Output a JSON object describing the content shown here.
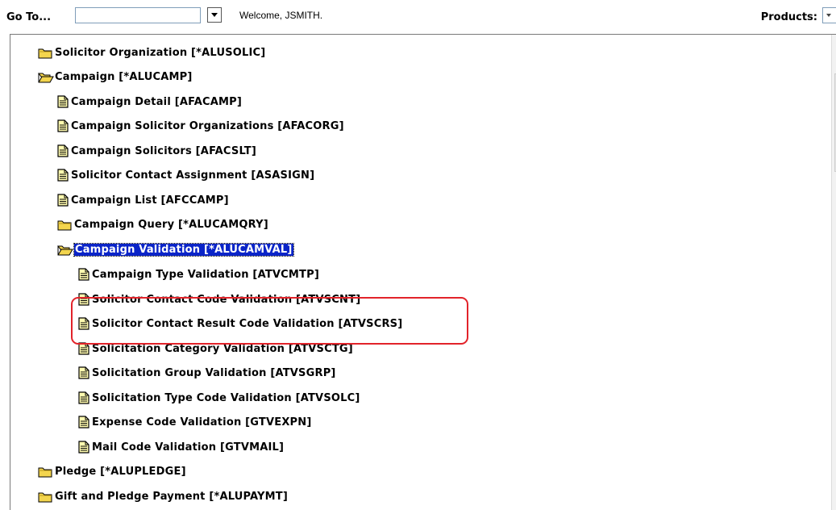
{
  "toolbar": {
    "goto_label": "Go To...",
    "goto_value": "",
    "welcome_text": "Welcome, JSMITH.",
    "products_label": "Products:"
  },
  "tree": {
    "items": [
      {
        "label": "Solicitor Organization [*ALUSOLIC]",
        "type": "folder"
      },
      {
        "label": "Campaign [*ALUCAMP]",
        "type": "folder-open"
      },
      {
        "label": "Campaign Detail [AFACAMP]",
        "type": "document"
      },
      {
        "label": "Campaign Solicitor Organizations [AFACORG]",
        "type": "document"
      },
      {
        "label": "Campaign Solicitors [AFACSLT]",
        "type": "document"
      },
      {
        "label": "Solicitor Contact Assignment [ASASIGN]",
        "type": "document"
      },
      {
        "label": "Campaign List [AFCCAMP]",
        "type": "document"
      },
      {
        "label": "Campaign Query [*ALUCAMQRY]",
        "type": "folder"
      },
      {
        "label": "Campaign Validation [*ALUCAMVAL]",
        "type": "folder-open",
        "selected": true
      },
      {
        "label": "Campaign Type Validation [ATVCMTP]",
        "type": "document"
      },
      {
        "label": "Solicitor Contact Code Validation [ATVSCNT]",
        "type": "document"
      },
      {
        "label": "Solicitor Contact Result Code Validation [ATVSCRS]",
        "type": "document"
      },
      {
        "label": "Solicitation Category Validation [ATVSCTG]",
        "type": "document",
        "highlighted": true
      },
      {
        "label": "Solicitation Group Validation [ATVSGRP]",
        "type": "document",
        "highlighted": true
      },
      {
        "label": "Solicitation Type Code Validation [ATVSOLC]",
        "type": "document"
      },
      {
        "label": "Expense Code Validation [GTVEXPN]",
        "type": "document"
      },
      {
        "label": "Mail Code Validation [GTVMAIL]",
        "type": "document"
      },
      {
        "label": "Pledge [*ALUPLEDGE]",
        "type": "folder"
      },
      {
        "label": "Gift and Pledge Payment [*ALUPAYMT]",
        "type": "folder"
      }
    ]
  },
  "colors": {
    "selection": "#0a24c8",
    "highlight_border": "#e2232a",
    "folder_fill": "#f3d54e",
    "document_fill": "#fffbb0"
  },
  "icons": {
    "folder": "folder-icon",
    "folder_open": "folder-open-icon",
    "document": "document-icon",
    "dropdown": "chevron-down-icon"
  }
}
